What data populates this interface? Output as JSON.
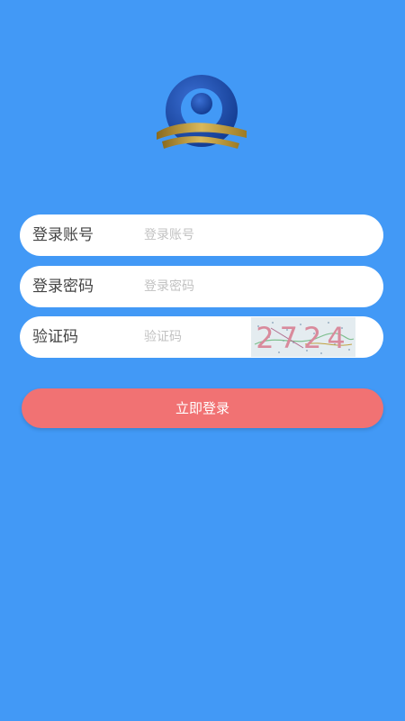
{
  "login_form": {
    "account": {
      "label": "登录账号",
      "placeholder": "登录账号"
    },
    "password": {
      "label": "登录密码",
      "placeholder": "登录密码"
    },
    "captcha": {
      "label": "验证码",
      "placeholder": "验证码",
      "image_text": "2724"
    },
    "submit_label": "立即登录"
  },
  "colors": {
    "background": "#4299f6",
    "button": "#f17273",
    "logo_blue": "#1a47a8",
    "logo_gold": "#b08a2e"
  }
}
